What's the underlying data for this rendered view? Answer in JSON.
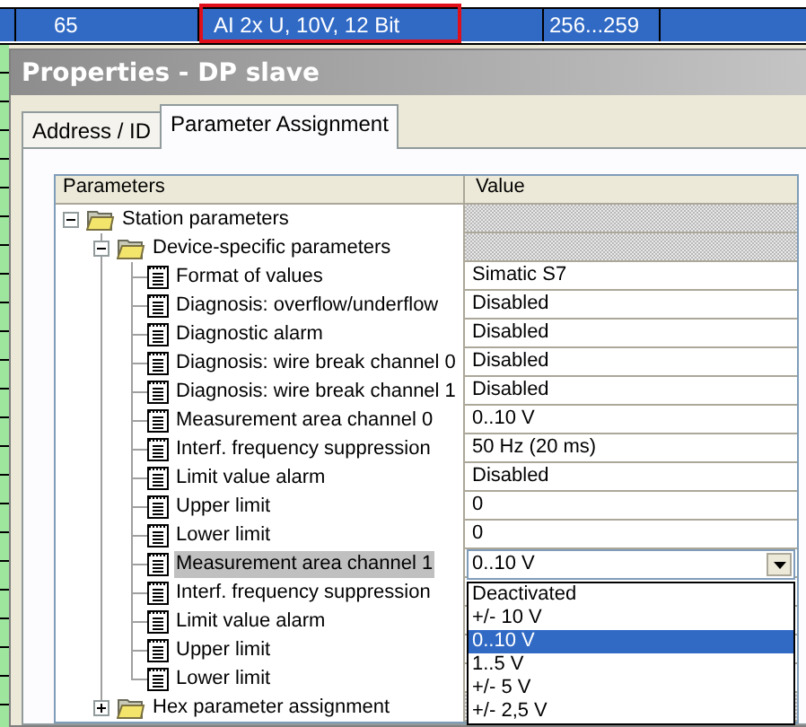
{
  "background_table": {
    "row": {
      "selected": true,
      "cells": [
        {
          "text": "65",
          "highlighted": false
        },
        {
          "text": "AI 2x U, 10V, 12 Bit",
          "highlighted": true
        },
        {
          "text": "256...259",
          "highlighted": false
        }
      ]
    }
  },
  "dialog": {
    "title": "Properties - DP slave",
    "tabs": [
      {
        "label": "Address / ID",
        "selected": false
      },
      {
        "label": "Parameter Assignment",
        "selected": true
      }
    ],
    "grid": {
      "columns": [
        "Parameters",
        "Value"
      ],
      "tree": [
        {
          "label": "Station parameters",
          "kind": "folder",
          "expanded": true,
          "children": [
            {
              "label": "Device-specific parameters",
              "kind": "folder",
              "expanded": true,
              "children": [
                {
                  "label": "Format of values",
                  "kind": "param",
                  "selected": false,
                  "value": "Simatic S7"
                },
                {
                  "label": "Diagnosis: overflow/underflow",
                  "kind": "param",
                  "selected": false,
                  "value": "Disabled"
                },
                {
                  "label": "Diagnostic alarm",
                  "kind": "param",
                  "selected": false,
                  "value": "Disabled"
                },
                {
                  "label": "Diagnosis: wire break channel 0",
                  "kind": "param",
                  "selected": false,
                  "value": "Disabled"
                },
                {
                  "label": "Diagnosis: wire break channel 1",
                  "kind": "param",
                  "selected": false,
                  "value": "Disabled"
                },
                {
                  "label": "Measurement area channel 0",
                  "kind": "param",
                  "selected": false,
                  "value": "0..10 V"
                },
                {
                  "label": "Interf. frequency suppression",
                  "kind": "param",
                  "selected": false,
                  "value": "50 Hz (20 ms)"
                },
                {
                  "label": "Limit value alarm",
                  "kind": "param",
                  "selected": false,
                  "value": "Disabled"
                },
                {
                  "label": "Upper limit",
                  "kind": "param",
                  "selected": false,
                  "value": "0"
                },
                {
                  "label": "Lower limit",
                  "kind": "param",
                  "selected": false,
                  "value": "0"
                },
                {
                  "label": "Measurement area channel 1",
                  "kind": "param",
                  "selected": true,
                  "value": "0..10 V",
                  "options": [
                    {
                      "label": "Deactivated",
                      "selected": false
                    },
                    {
                      "label": "+/- 10 V",
                      "selected": false
                    },
                    {
                      "label": "0..10 V",
                      "selected": true
                    },
                    {
                      "label": "1..5 V",
                      "selected": false
                    },
                    {
                      "label": "+/- 5 V",
                      "selected": false
                    },
                    {
                      "label": "+/- 2,5 V",
                      "selected": false
                    }
                  ]
                },
                {
                  "label": "Interf. frequency suppression",
                  "kind": "param",
                  "selected": false
                },
                {
                  "label": "Limit value alarm",
                  "kind": "param",
                  "selected": false
                },
                {
                  "label": "Upper limit",
                  "kind": "param",
                  "selected": false
                },
                {
                  "label": "Lower limit",
                  "kind": "param",
                  "selected": false
                }
              ]
            },
            {
              "label": "Hex parameter assignment",
              "kind": "folder",
              "expanded": false
            }
          ]
        }
      ]
    }
  }
}
